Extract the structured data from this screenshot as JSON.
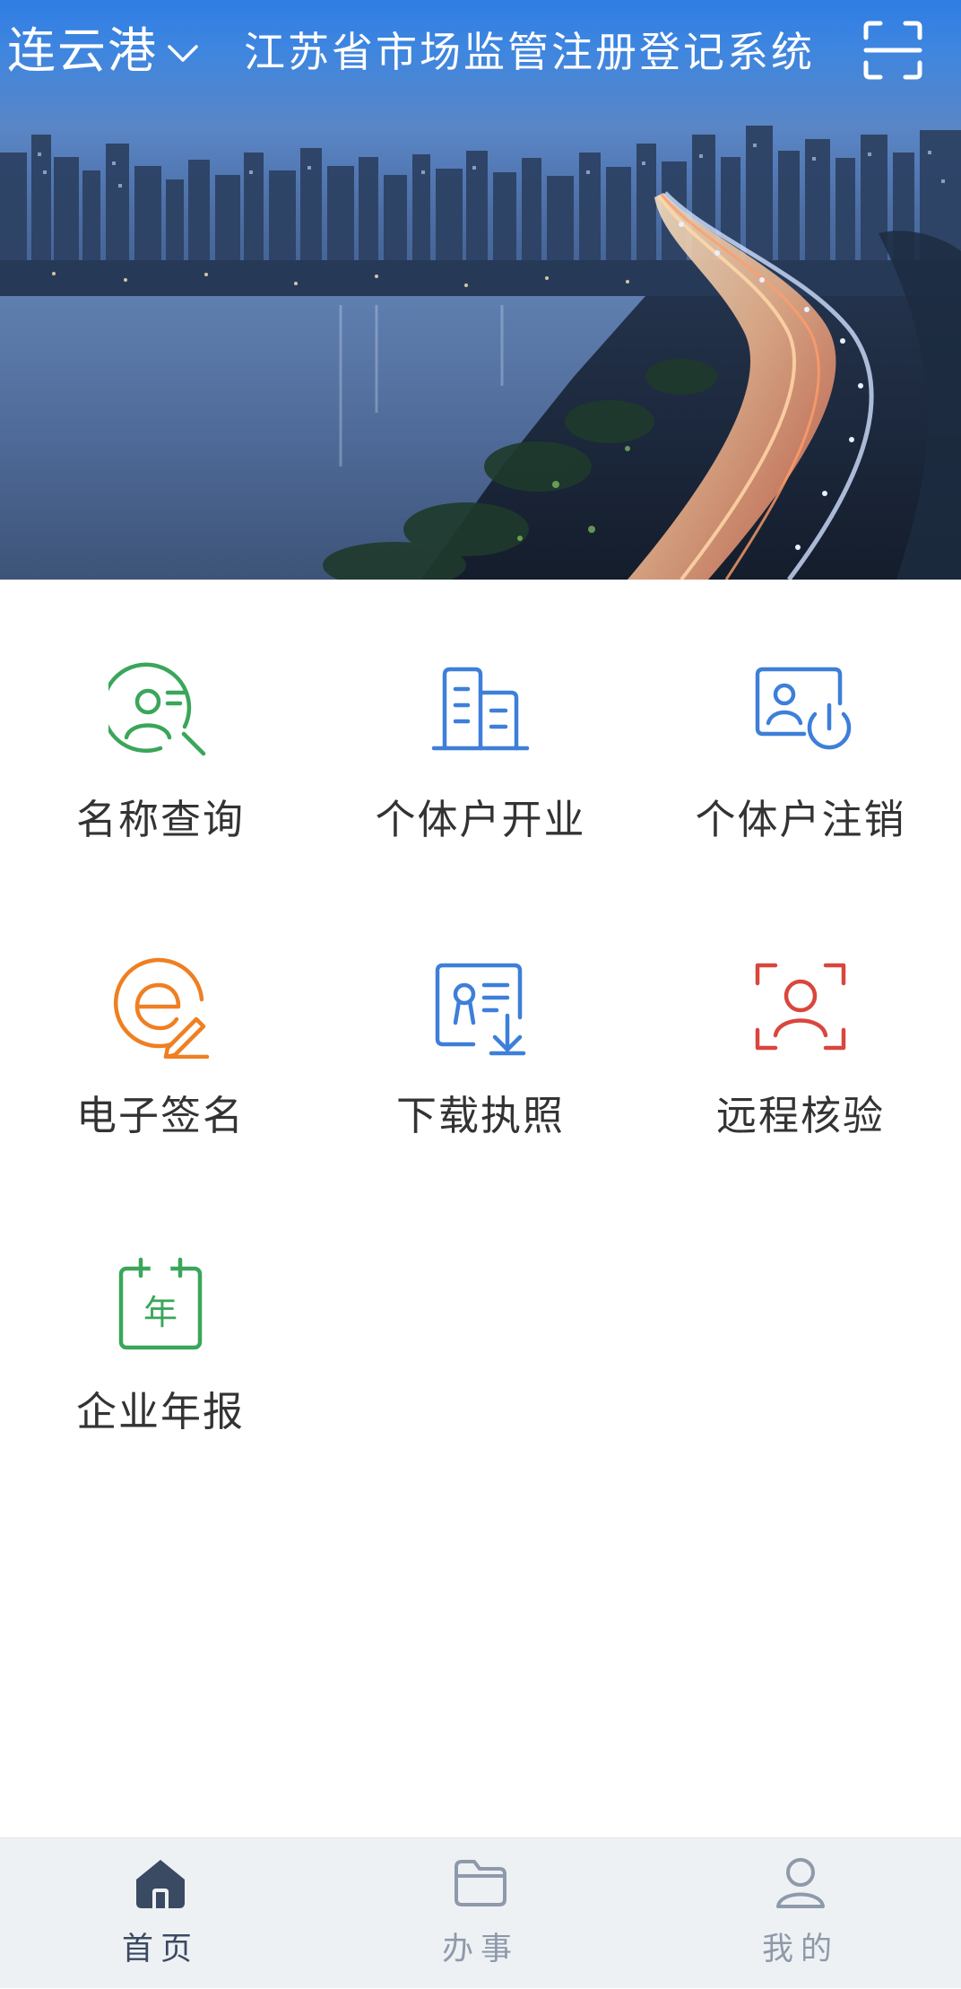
{
  "header": {
    "city": "连云港",
    "title": "江苏省市场监管注册登记系统",
    "scan_icon": "scan-icon",
    "chevron_icon": "chevron-down-icon"
  },
  "banner": {
    "description_icon": "city-night-bridge-banner"
  },
  "services": [
    {
      "label": "名称查询",
      "icon": "name-search-icon",
      "color": "#3aa65a"
    },
    {
      "label": "个体户开业",
      "icon": "building-icon",
      "color": "#3d7fd9"
    },
    {
      "label": "个体户注销",
      "icon": "deregister-icon",
      "color": "#3d7fd9"
    },
    {
      "label": "电子签名",
      "icon": "e-sign-icon",
      "color": "#ef7f22"
    },
    {
      "label": "下载执照",
      "icon": "download-license-icon",
      "color": "#3d7fd9"
    },
    {
      "label": "远程核验",
      "icon": "remote-verify-icon",
      "color": "#d9463e"
    },
    {
      "label": "企业年报",
      "icon": "annual-report-icon",
      "color": "#3aa65a"
    }
  ],
  "tabbar": {
    "tabs": [
      {
        "label": "首页",
        "icon": "home-icon",
        "active": true
      },
      {
        "label": "办事",
        "icon": "folder-icon",
        "active": false
      },
      {
        "label": "我的",
        "icon": "user-icon",
        "active": false
      }
    ],
    "active_color": "#3b4a63",
    "inactive_color": "#8e9aab"
  }
}
